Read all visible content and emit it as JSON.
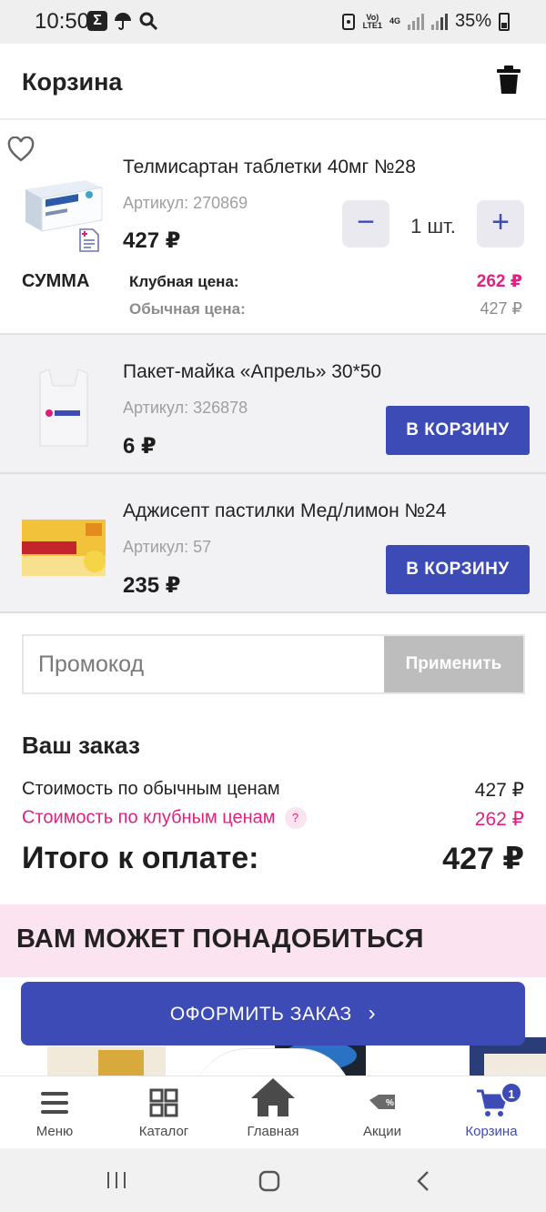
{
  "status_bar": {
    "time": "10:50",
    "battery": "35%",
    "network_top": "Vo)",
    "network_bottom": "LTE1",
    "net_type": "4G"
  },
  "header": {
    "title": "Корзина",
    "trash_icon": "trash-icon"
  },
  "cart_item": {
    "name": "Телмисартан таблетки 40мг №28",
    "sku": "Артикул: 270869",
    "price": "427 ₽",
    "quantity": "1 шт.",
    "minus": "−",
    "plus": "+",
    "sum_label": "СУММА",
    "club_label": "Клубная цена:",
    "club_price": "262 ₽",
    "regular_label": "Обычная цена:",
    "regular_price": "427 ₽"
  },
  "suggested": [
    {
      "name": "Пакет-майка «Апрель» 30*50",
      "sku": "Артикул: 326878",
      "price": "6 ₽",
      "button": "В КОРЗИНУ"
    },
    {
      "name": "Аджисепт пастилки Мед/лимон №24",
      "sku": "Артикул: 57",
      "price": "235 ₽",
      "button": "В КОРЗИНУ"
    }
  ],
  "promo": {
    "placeholder": "Промокод",
    "apply": "Применить"
  },
  "order": {
    "title": "Ваш заказ",
    "regular_label": "Стоимость по обычным ценам",
    "regular_value": "427 ₽",
    "club_label": "Стоимость по клубным ценам",
    "club_help": "?",
    "club_value": "262 ₽",
    "total_label": "Итого к оплате:",
    "total_value": "427 ₽"
  },
  "recommend": {
    "title": "ВАМ МОЖЕТ ПОНАДОБИТЬСЯ"
  },
  "checkout": {
    "label": "ОФОРМИТЬ ЗАКАЗ",
    "chevron": "›"
  },
  "bottom_nav": {
    "items": [
      {
        "label": "Меню",
        "icon": "menu-icon"
      },
      {
        "label": "Каталог",
        "icon": "catalog-icon"
      },
      {
        "label": "Главная",
        "icon": "home-icon"
      },
      {
        "label": "Акции",
        "icon": "tag-icon"
      },
      {
        "label": "Корзина",
        "icon": "cart-icon"
      }
    ],
    "cart_count": "1"
  },
  "colors": {
    "accent": "#3d4bb7",
    "club": "#e0217f",
    "promo_disabled": "#bdbdbd",
    "recommend_bg": "#fbe3ef"
  }
}
